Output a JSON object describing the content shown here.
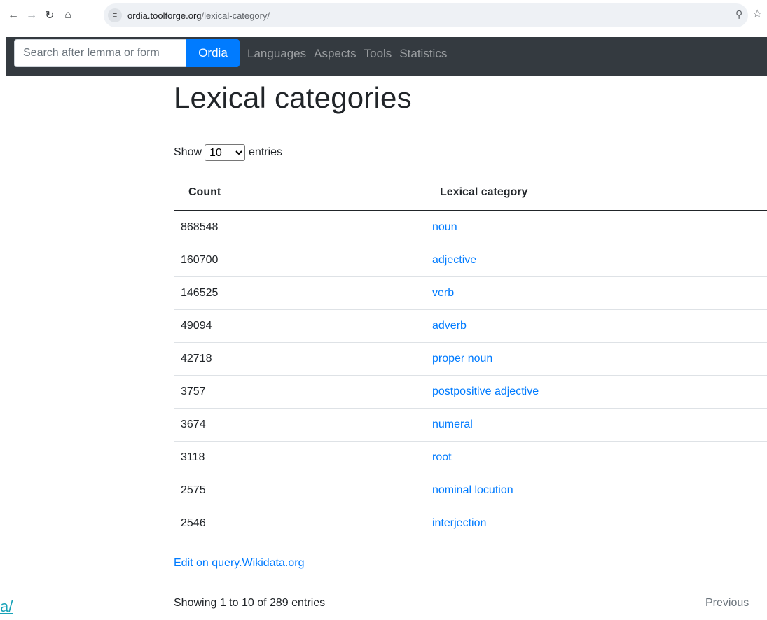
{
  "browser": {
    "url_host": "ordia.toolforge.org",
    "url_path": "/lexical-category/",
    "icons": [
      "back-arrow-icon",
      "forward-arrow-icon",
      "reload-icon",
      "home-icon",
      "site-settings-icon",
      "zoom-icon",
      "bookmark-star-icon"
    ]
  },
  "navbar": {
    "search_placeholder": "Search after lemma or form",
    "brand": "Ordia",
    "links": [
      "Languages",
      "Aspects",
      "Tools",
      "Statistics"
    ]
  },
  "page": {
    "title": "Lexical categories",
    "length": {
      "prefix": "Show",
      "selected": "10",
      "suffix": "entries"
    },
    "table": {
      "headers": [
        "Count",
        "Lexical category"
      ],
      "rows": [
        {
          "count": "868548",
          "category": "noun"
        },
        {
          "count": "160700",
          "category": "adjective"
        },
        {
          "count": "146525",
          "category": "verb"
        },
        {
          "count": "49094",
          "category": "adverb"
        },
        {
          "count": "42718",
          "category": "proper noun"
        },
        {
          "count": "3757",
          "category": "postpositive adjective"
        },
        {
          "count": "3674",
          "category": "numeral"
        },
        {
          "count": "3118",
          "category": "root"
        },
        {
          "count": "2575",
          "category": "nominal locution"
        },
        {
          "count": "2546",
          "category": "interjection"
        }
      ]
    },
    "edit_link": "Edit on query.Wikidata.org",
    "info": "Showing 1 to 10 of 289 entries",
    "previous": "Previous",
    "stray_link": "a/"
  },
  "colors": {
    "navbar_bg": "#343a40",
    "brand_blue": "#007bff",
    "link_blue": "#007bff"
  }
}
